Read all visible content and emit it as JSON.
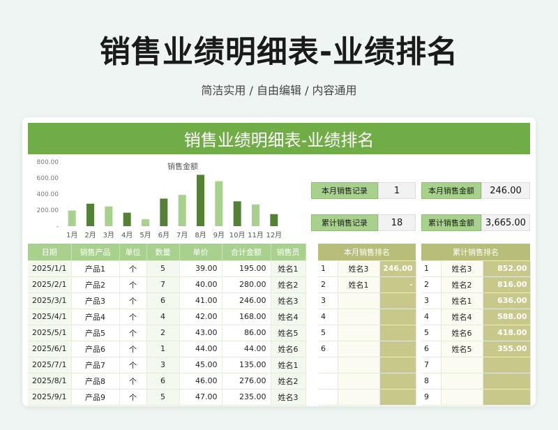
{
  "page": {
    "title": "销售业绩明细表-业绩排名",
    "subtitle": "简洁实用 / 自由编辑 / 内容通用"
  },
  "sheet": {
    "banner": "销售业绩明细表-业绩排名"
  },
  "chart_data": {
    "type": "bar",
    "title": "销售金额",
    "categories": [
      "1月",
      "2月",
      "3月",
      "4月",
      "5月",
      "6月",
      "7月",
      "8月",
      "9月",
      "10月",
      "11月",
      "12月"
    ],
    "values": [
      195,
      280,
      246,
      168,
      86,
      344,
      390,
      640,
      560,
      310,
      270,
      150
    ],
    "ylim": [
      0,
      800
    ],
    "yticks": [
      "800.00",
      "600.00",
      "400.00",
      "200.00",
      "-"
    ],
    "colors": [
      "#a9d18e",
      "#548235"
    ]
  },
  "stats": {
    "month_count_label": "本月销售记录",
    "month_count_value": "1",
    "month_amount_label": "本月销售金额",
    "month_amount_value": "246.00",
    "total_count_label": "累计销售记录",
    "total_count_value": "18",
    "total_amount_label": "累计销售金额",
    "total_amount_value": "3,665.00"
  },
  "detail": {
    "headers": [
      "日期",
      "销售产品",
      "单位",
      "数量",
      "单价",
      "合计金额",
      "销售员"
    ],
    "rows": [
      [
        "2025/1/1",
        "产品1",
        "个",
        "5",
        "39.00",
        "195.00",
        "姓名1"
      ],
      [
        "2025/2/1",
        "产品2",
        "个",
        "7",
        "40.00",
        "280.00",
        "姓名2"
      ],
      [
        "2025/3/1",
        "产品3",
        "个",
        "6",
        "41.00",
        "246.00",
        "姓名3"
      ],
      [
        "2025/4/1",
        "产品4",
        "个",
        "4",
        "42.00",
        "168.00",
        "姓名4"
      ],
      [
        "2025/5/1",
        "产品5",
        "个",
        "2",
        "43.00",
        "86.00",
        "姓名5"
      ],
      [
        "2025/6/1",
        "产品6",
        "个",
        "1",
        "44.00",
        "44.00",
        "姓名6"
      ],
      [
        "2025/7/1",
        "产品7",
        "个",
        "3",
        "45.00",
        "135.00",
        "姓名1"
      ],
      [
        "2025/8/1",
        "产品8",
        "个",
        "6",
        "46.00",
        "276.00",
        "姓名2"
      ],
      [
        "2025/9/1",
        "产品9",
        "个",
        "5",
        "47.00",
        "235.00",
        "姓名3"
      ]
    ]
  },
  "month_rank": {
    "title": "本月销售排名",
    "rows": [
      [
        "1",
        "姓名3",
        "246.00"
      ],
      [
        "2",
        "姓名1",
        "-"
      ],
      [
        "3",
        "",
        ""
      ],
      [
        "4",
        "",
        ""
      ],
      [
        "5",
        "",
        ""
      ],
      [
        "6",
        "",
        ""
      ],
      [
        "",
        "",
        ""
      ],
      [
        "",
        "",
        ""
      ],
      [
        "",
        "",
        ""
      ]
    ]
  },
  "total_rank": {
    "title": "累计销售排名",
    "rows": [
      [
        "1",
        "姓名3",
        "852.00"
      ],
      [
        "2",
        "姓名2",
        "816.00"
      ],
      [
        "3",
        "姓名1",
        "636.00"
      ],
      [
        "4",
        "姓名4",
        "588.00"
      ],
      [
        "5",
        "姓名6",
        "418.00"
      ],
      [
        "6",
        "姓名5",
        "355.00"
      ],
      [
        "7",
        "",
        ""
      ],
      [
        "8",
        "",
        ""
      ],
      [
        "9",
        "",
        ""
      ]
    ]
  }
}
